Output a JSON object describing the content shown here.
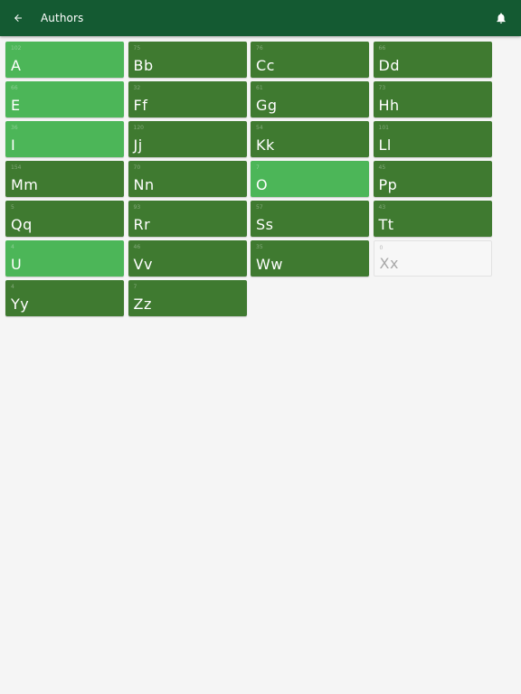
{
  "appbar": {
    "title": "Authors",
    "back_icon": "arrow-left-icon",
    "bell_icon": "bell-icon"
  },
  "colors": {
    "appbar": "#145a32",
    "tile_dark": "#3f7a30",
    "tile_light": "#4cb658",
    "background": "#f5f5f5"
  },
  "tiles": [
    {
      "count": "102",
      "letter": "A",
      "style": "light"
    },
    {
      "count": "75",
      "letter": "Bb",
      "style": "dark"
    },
    {
      "count": "76",
      "letter": "Cc",
      "style": "dark"
    },
    {
      "count": "66",
      "letter": "Dd",
      "style": "dark"
    },
    {
      "count": "66",
      "letter": "E",
      "style": "light"
    },
    {
      "count": "32",
      "letter": "Ff",
      "style": "dark"
    },
    {
      "count": "61",
      "letter": "Gg",
      "style": "dark"
    },
    {
      "count": "73",
      "letter": "Hh",
      "style": "dark"
    },
    {
      "count": "36",
      "letter": "I",
      "style": "light"
    },
    {
      "count": "120",
      "letter": "Jj",
      "style": "dark"
    },
    {
      "count": "54",
      "letter": "Kk",
      "style": "dark"
    },
    {
      "count": "101",
      "letter": "Ll",
      "style": "dark"
    },
    {
      "count": "154",
      "letter": "Mm",
      "style": "dark"
    },
    {
      "count": "70",
      "letter": "Nn",
      "style": "dark"
    },
    {
      "count": "7",
      "letter": "O",
      "style": "light"
    },
    {
      "count": "45",
      "letter": "Pp",
      "style": "dark"
    },
    {
      "count": "5",
      "letter": "Qq",
      "style": "dark"
    },
    {
      "count": "93",
      "letter": "Rr",
      "style": "dark"
    },
    {
      "count": "57",
      "letter": "Ss",
      "style": "dark"
    },
    {
      "count": "43",
      "letter": "Tt",
      "style": "dark"
    },
    {
      "count": "4",
      "letter": "U",
      "style": "light"
    },
    {
      "count": "46",
      "letter": "Vv",
      "style": "dark"
    },
    {
      "count": "35",
      "letter": "Ww",
      "style": "dark"
    },
    {
      "count": "0",
      "letter": "Xx",
      "style": "empty"
    },
    {
      "count": "4",
      "letter": "Yy",
      "style": "dark"
    },
    {
      "count": "7",
      "letter": "Zz",
      "style": "dark"
    }
  ]
}
